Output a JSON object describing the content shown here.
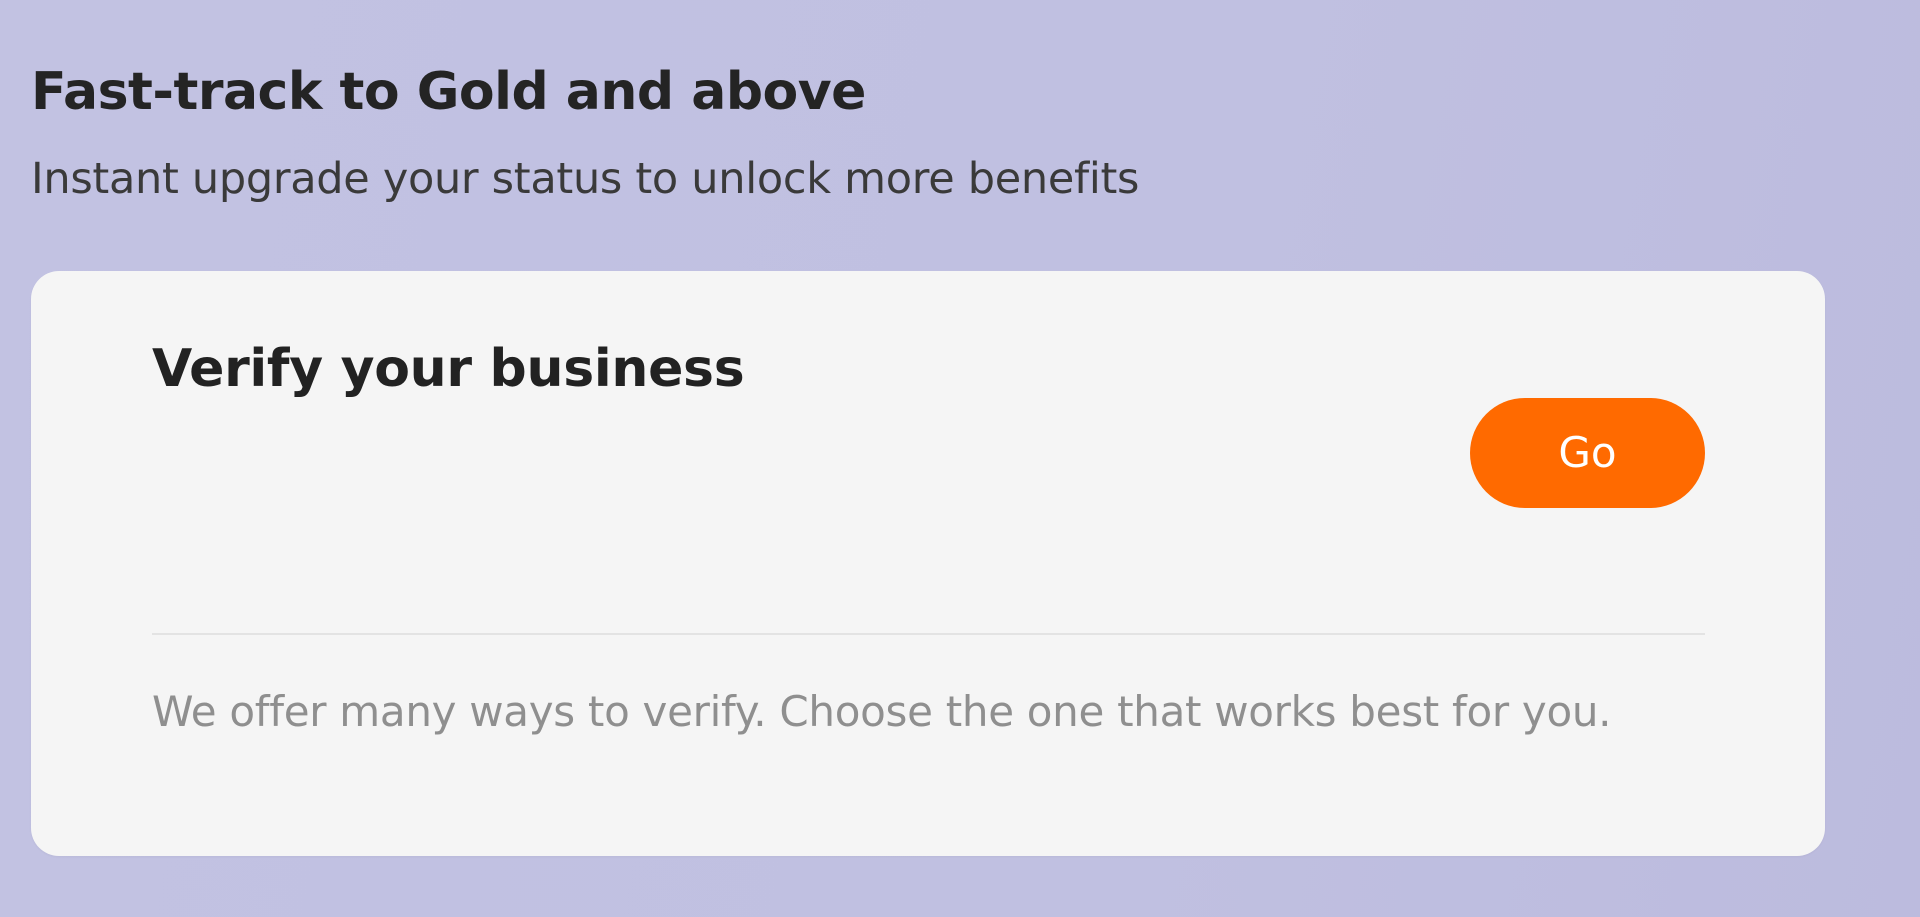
{
  "section": {
    "title": "Fast-track to Gold and above",
    "subtitle": "Instant upgrade your status to unlock more benefits"
  },
  "card": {
    "title": "Verify your business",
    "go_label": "Go",
    "description": "We offer many ways to verify. Choose the one that works best for you."
  },
  "colors": {
    "background": "#c1c1e1",
    "card_background": "#f5f5f5",
    "accent": "#ff6a00",
    "title_text": "#242424",
    "muted_text": "#8f8f8f"
  }
}
